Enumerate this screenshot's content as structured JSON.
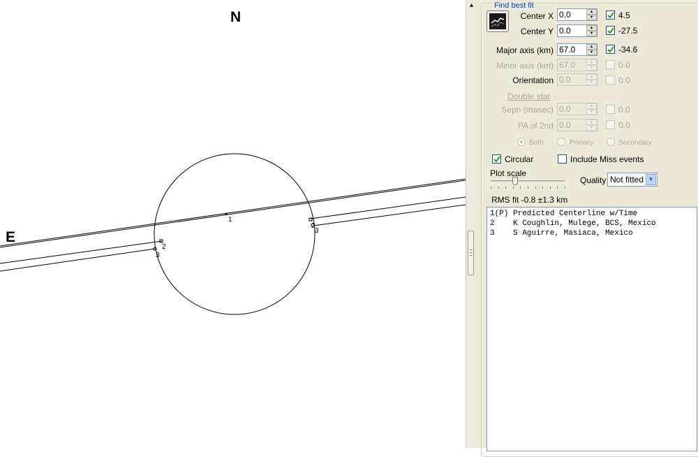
{
  "plot": {
    "compass_north": "N",
    "compass_east": "E",
    "chord_labels": [
      "1",
      "2",
      "3",
      "2",
      "3"
    ]
  },
  "panel": {
    "group_title": "Find best fit",
    "fit_button_icon": "fit-chart-icon",
    "fields": [
      {
        "label": "Center X",
        "value": "0.0",
        "enabled": true,
        "checked": true,
        "result": "4.5"
      },
      {
        "label": "Center Y",
        "value": "0.0",
        "enabled": true,
        "checked": true,
        "result": "-27.5"
      },
      {
        "label": "Major axis (km)",
        "value": "67.0",
        "enabled": true,
        "checked": true,
        "result": "-34.6"
      },
      {
        "label": "Minor axis (km)",
        "value": "67.0",
        "enabled": false,
        "checked": false,
        "result": "0.0"
      },
      {
        "label": "Orientation",
        "value": "0.0",
        "enabled": false,
        "checked": false,
        "result": "0.0"
      }
    ],
    "double_star": {
      "link": "Double star",
      "fields": [
        {
          "label": "Sepn (masec)",
          "value": "0.0",
          "enabled": false,
          "checked": false,
          "result": "0.0"
        },
        {
          "label": "PA of 2nd",
          "value": "0.0",
          "enabled": false,
          "checked": false,
          "result": "0.0"
        }
      ],
      "radios": [
        "Both",
        "Primary",
        "Secondary"
      ],
      "radio_selected": "Both"
    },
    "circular": {
      "label": "Circular",
      "checked": true
    },
    "include_miss": {
      "label": "Include Miss events",
      "checked": false
    },
    "plot_scale": {
      "label": "Plot scale",
      "level": 0.33
    },
    "quality": {
      "label": "Quality",
      "value": "Not fitted"
    },
    "rms": "RMS fit -0.8 ±1.3 km",
    "list_items": [
      "1(P) Predicted Centerline w/Time",
      "2    K Coughlin, Mulege, BCS, Mexico",
      "3    S Aguirre, Masiaca, Mexico"
    ]
  },
  "colors": {
    "panel_bg": "#ece9d8",
    "group_title": "#0046d5",
    "checkbox_check": "#21a121",
    "disabled_text": "#aca899"
  }
}
